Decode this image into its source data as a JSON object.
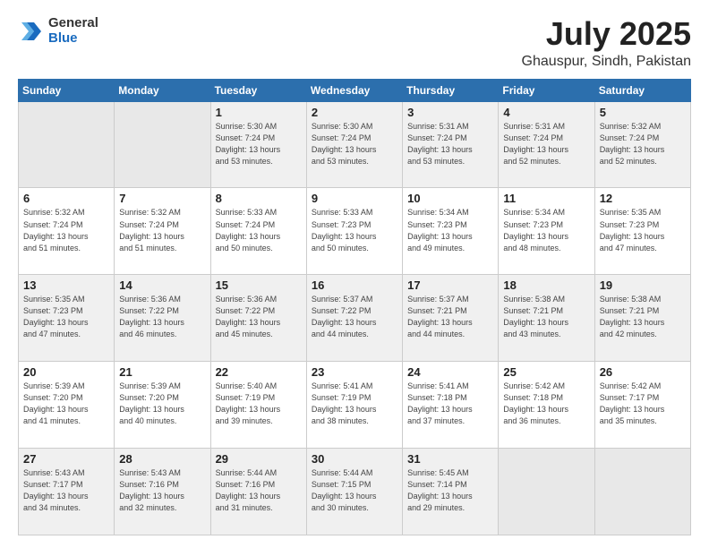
{
  "header": {
    "logo_general": "General",
    "logo_blue": "Blue",
    "month": "July 2025",
    "location": "Ghauspur, Sindh, Pakistan"
  },
  "weekdays": [
    "Sunday",
    "Monday",
    "Tuesday",
    "Wednesday",
    "Thursday",
    "Friday",
    "Saturday"
  ],
  "rows": [
    [
      {
        "num": "",
        "info": ""
      },
      {
        "num": "",
        "info": ""
      },
      {
        "num": "1",
        "info": "Sunrise: 5:30 AM\nSunset: 7:24 PM\nDaylight: 13 hours\nand 53 minutes."
      },
      {
        "num": "2",
        "info": "Sunrise: 5:30 AM\nSunset: 7:24 PM\nDaylight: 13 hours\nand 53 minutes."
      },
      {
        "num": "3",
        "info": "Sunrise: 5:31 AM\nSunset: 7:24 PM\nDaylight: 13 hours\nand 53 minutes."
      },
      {
        "num": "4",
        "info": "Sunrise: 5:31 AM\nSunset: 7:24 PM\nDaylight: 13 hours\nand 52 minutes."
      },
      {
        "num": "5",
        "info": "Sunrise: 5:32 AM\nSunset: 7:24 PM\nDaylight: 13 hours\nand 52 minutes."
      }
    ],
    [
      {
        "num": "6",
        "info": "Sunrise: 5:32 AM\nSunset: 7:24 PM\nDaylight: 13 hours\nand 51 minutes."
      },
      {
        "num": "7",
        "info": "Sunrise: 5:32 AM\nSunset: 7:24 PM\nDaylight: 13 hours\nand 51 minutes."
      },
      {
        "num": "8",
        "info": "Sunrise: 5:33 AM\nSunset: 7:24 PM\nDaylight: 13 hours\nand 50 minutes."
      },
      {
        "num": "9",
        "info": "Sunrise: 5:33 AM\nSunset: 7:23 PM\nDaylight: 13 hours\nand 50 minutes."
      },
      {
        "num": "10",
        "info": "Sunrise: 5:34 AM\nSunset: 7:23 PM\nDaylight: 13 hours\nand 49 minutes."
      },
      {
        "num": "11",
        "info": "Sunrise: 5:34 AM\nSunset: 7:23 PM\nDaylight: 13 hours\nand 48 minutes."
      },
      {
        "num": "12",
        "info": "Sunrise: 5:35 AM\nSunset: 7:23 PM\nDaylight: 13 hours\nand 47 minutes."
      }
    ],
    [
      {
        "num": "13",
        "info": "Sunrise: 5:35 AM\nSunset: 7:23 PM\nDaylight: 13 hours\nand 47 minutes."
      },
      {
        "num": "14",
        "info": "Sunrise: 5:36 AM\nSunset: 7:22 PM\nDaylight: 13 hours\nand 46 minutes."
      },
      {
        "num": "15",
        "info": "Sunrise: 5:36 AM\nSunset: 7:22 PM\nDaylight: 13 hours\nand 45 minutes."
      },
      {
        "num": "16",
        "info": "Sunrise: 5:37 AM\nSunset: 7:22 PM\nDaylight: 13 hours\nand 44 minutes."
      },
      {
        "num": "17",
        "info": "Sunrise: 5:37 AM\nSunset: 7:21 PM\nDaylight: 13 hours\nand 44 minutes."
      },
      {
        "num": "18",
        "info": "Sunrise: 5:38 AM\nSunset: 7:21 PM\nDaylight: 13 hours\nand 43 minutes."
      },
      {
        "num": "19",
        "info": "Sunrise: 5:38 AM\nSunset: 7:21 PM\nDaylight: 13 hours\nand 42 minutes."
      }
    ],
    [
      {
        "num": "20",
        "info": "Sunrise: 5:39 AM\nSunset: 7:20 PM\nDaylight: 13 hours\nand 41 minutes."
      },
      {
        "num": "21",
        "info": "Sunrise: 5:39 AM\nSunset: 7:20 PM\nDaylight: 13 hours\nand 40 minutes."
      },
      {
        "num": "22",
        "info": "Sunrise: 5:40 AM\nSunset: 7:19 PM\nDaylight: 13 hours\nand 39 minutes."
      },
      {
        "num": "23",
        "info": "Sunrise: 5:41 AM\nSunset: 7:19 PM\nDaylight: 13 hours\nand 38 minutes."
      },
      {
        "num": "24",
        "info": "Sunrise: 5:41 AM\nSunset: 7:18 PM\nDaylight: 13 hours\nand 37 minutes."
      },
      {
        "num": "25",
        "info": "Sunrise: 5:42 AM\nSunset: 7:18 PM\nDaylight: 13 hours\nand 36 minutes."
      },
      {
        "num": "26",
        "info": "Sunrise: 5:42 AM\nSunset: 7:17 PM\nDaylight: 13 hours\nand 35 minutes."
      }
    ],
    [
      {
        "num": "27",
        "info": "Sunrise: 5:43 AM\nSunset: 7:17 PM\nDaylight: 13 hours\nand 34 minutes."
      },
      {
        "num": "28",
        "info": "Sunrise: 5:43 AM\nSunset: 7:16 PM\nDaylight: 13 hours\nand 32 minutes."
      },
      {
        "num": "29",
        "info": "Sunrise: 5:44 AM\nSunset: 7:16 PM\nDaylight: 13 hours\nand 31 minutes."
      },
      {
        "num": "30",
        "info": "Sunrise: 5:44 AM\nSunset: 7:15 PM\nDaylight: 13 hours\nand 30 minutes."
      },
      {
        "num": "31",
        "info": "Sunrise: 5:45 AM\nSunset: 7:14 PM\nDaylight: 13 hours\nand 29 minutes."
      },
      {
        "num": "",
        "info": ""
      },
      {
        "num": "",
        "info": ""
      }
    ]
  ]
}
